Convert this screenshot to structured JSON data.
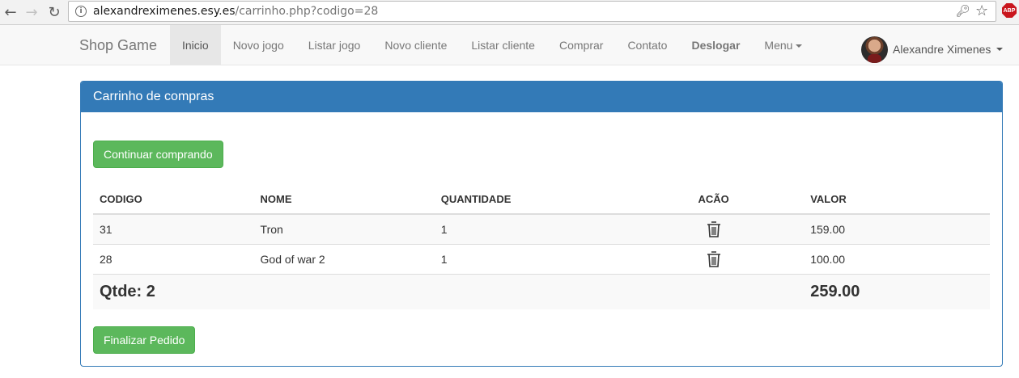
{
  "browser": {
    "url_domain": "alexandreximenes.esy.es",
    "url_path": "/carrinho.php?codigo=28",
    "abp_label": "ABP"
  },
  "navbar": {
    "brand": "Shop Game",
    "items": [
      {
        "label": "Inicio",
        "active": true
      },
      {
        "label": "Novo jogo"
      },
      {
        "label": "Listar jogo"
      },
      {
        "label": "Novo cliente"
      },
      {
        "label": "Listar cliente"
      },
      {
        "label": "Comprar"
      },
      {
        "label": "Contato"
      },
      {
        "label": "Deslogar",
        "bold": true
      },
      {
        "label": "Menu",
        "dropdown": true
      }
    ],
    "user_name": "Alexandre Ximenes"
  },
  "cart": {
    "title": "Carrinho de compras",
    "continue_label": "Continuar comprando",
    "finish_label": "Finalizar Pedido",
    "columns": [
      "CODIGO",
      "NOME",
      "QUANTIDADE",
      "ACÃO",
      "VALOR"
    ],
    "rows": [
      {
        "codigo": "31",
        "nome": "Tron",
        "quantidade": "1",
        "valor": "159.00"
      },
      {
        "codigo": "28",
        "nome": "God of war 2",
        "quantidade": "1",
        "valor": "100.00"
      }
    ],
    "total_qty_label": "Qtde: 2",
    "total_value": "259.00"
  },
  "colors": {
    "primary": "#337ab7",
    "success": "#5cb85c"
  },
  "icons": {
    "delete": "trash-icon"
  }
}
